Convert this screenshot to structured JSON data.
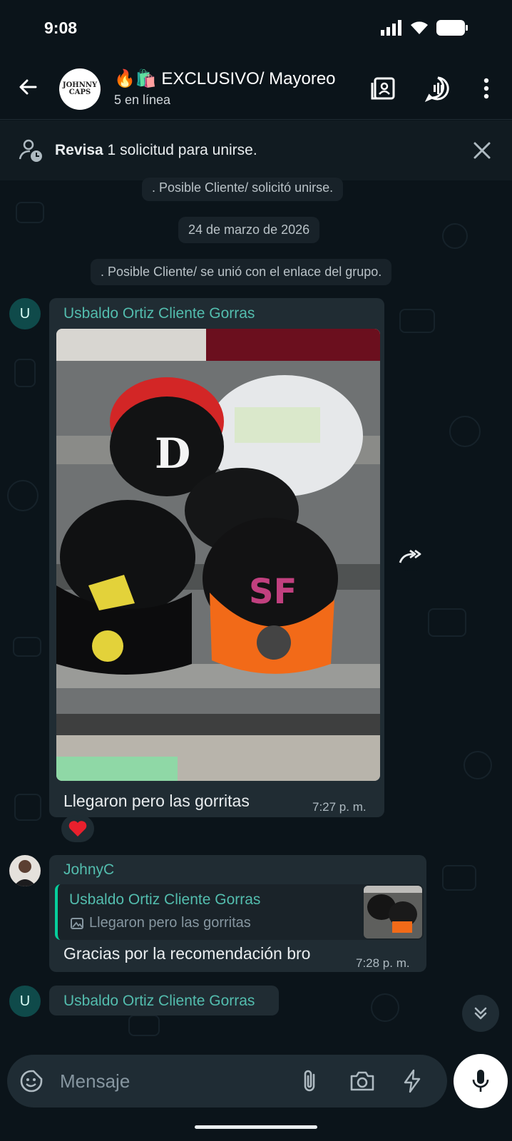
{
  "status_bar": {
    "time": "9:08"
  },
  "header": {
    "title": "🔥🛍️ EXCLUSIVO/ Mayoreo",
    "subtitle": "5 en línea",
    "avatar_text": "JOHNNY CAPS"
  },
  "join_banner": {
    "bold": "Revisa",
    "text": " 1 solicitud para unirse."
  },
  "system_messages": [
    ". Posible Cliente/ solicitó unirse.",
    "24 de marzo de 2026",
    ". Posible Cliente/ se unió con el enlace del grupo."
  ],
  "messages": [
    {
      "sender": "Usbaldo Ortiz Cliente Gorras",
      "avatar_letter": "U",
      "text": "Llegaron pero las gorritas",
      "time": "7:27 p. m.",
      "reaction": "❤️"
    },
    {
      "sender": "JohnyC",
      "quote_sender": "Usbaldo Ortiz Cliente Gorras",
      "quote_text": "Llegaron pero las gorritas",
      "text": "Gracias por la recomendación bro",
      "time": "7:28 p. m."
    },
    {
      "sender": "Usbaldo Ortiz Cliente Gorras",
      "avatar_letter": "U"
    }
  ],
  "input": {
    "placeholder": "Mensaje"
  },
  "colors": {
    "background": "#0b141a",
    "bubble": "#202c33",
    "sender_name": "#53bdae",
    "quote_bar": "#06cf9c"
  }
}
